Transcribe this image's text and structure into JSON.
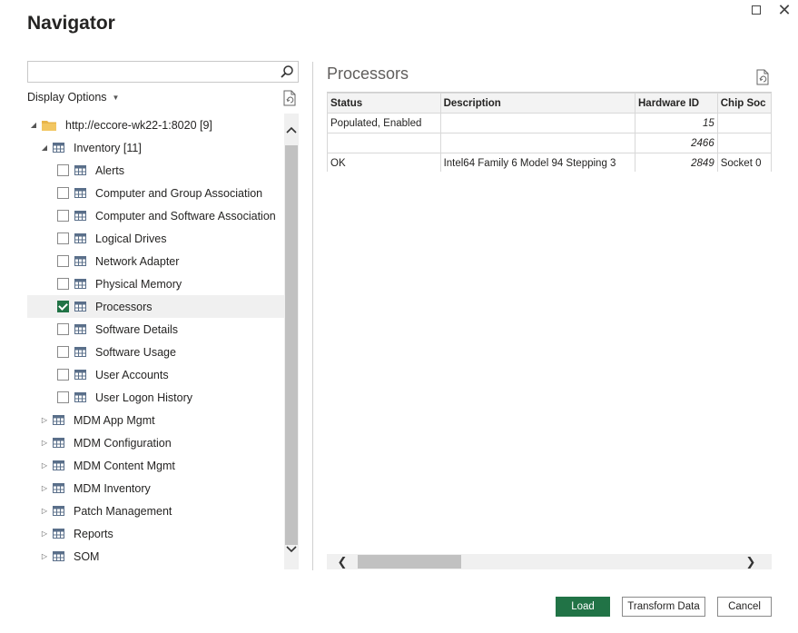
{
  "window": {
    "title": "Navigator"
  },
  "search": {
    "placeholder": "",
    "value": ""
  },
  "display_options_label": "Display Options",
  "tree": {
    "root": {
      "label": "http://eccore-wk22-1:8020 [9]",
      "expanded": true
    },
    "inventory": {
      "label": "Inventory [11]",
      "expanded": true
    },
    "inventory_items": [
      {
        "label": "Alerts",
        "checked": false
      },
      {
        "label": "Computer and Group Association",
        "checked": false
      },
      {
        "label": "Computer and Software Association",
        "checked": false
      },
      {
        "label": "Logical Drives",
        "checked": false
      },
      {
        "label": "Network Adapter",
        "checked": false
      },
      {
        "label": "Physical Memory",
        "checked": false
      },
      {
        "label": "Processors",
        "checked": true,
        "selected": true
      },
      {
        "label": "Software Details",
        "checked": false
      },
      {
        "label": "Software Usage",
        "checked": false
      },
      {
        "label": "User Accounts",
        "checked": false
      },
      {
        "label": "User Logon History",
        "checked": false
      }
    ],
    "collapsed_groups": [
      {
        "label": "MDM App Mgmt"
      },
      {
        "label": "MDM Configuration"
      },
      {
        "label": "MDM Content Mgmt"
      },
      {
        "label": "MDM Inventory"
      },
      {
        "label": "Patch Management"
      },
      {
        "label": "Reports"
      },
      {
        "label": "SOM"
      }
    ]
  },
  "preview": {
    "title": "Processors",
    "columns": [
      "Status",
      "Description",
      "Hardware ID",
      "Chip Soc"
    ],
    "rows": [
      [
        "Populated, Enabled",
        "",
        "15",
        ""
      ],
      [
        "",
        "",
        "2466",
        ""
      ],
      [
        "OK",
        "Intel64 Family 6 Model 94 Stepping 3",
        "2849",
        "Socket 0"
      ]
    ]
  },
  "buttons": {
    "load": "Load",
    "transform": "Transform Data",
    "cancel": "Cancel"
  },
  "colors": {
    "accent": "#217346",
    "selected_row": "#f0f0f0"
  }
}
